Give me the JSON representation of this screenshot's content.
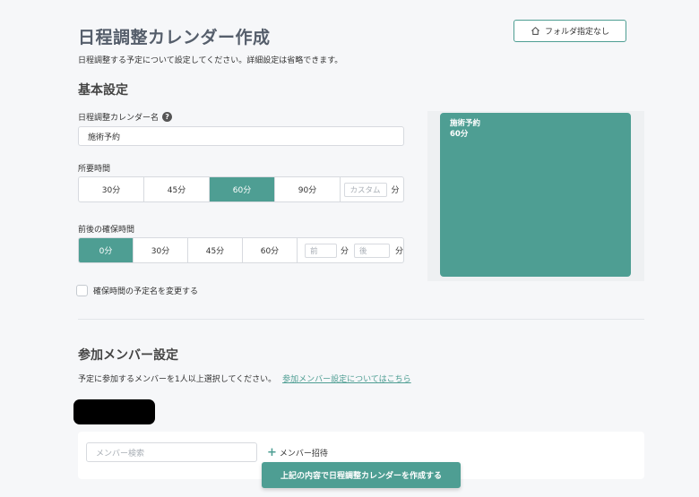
{
  "header": {
    "title": "日程調整カレンダー作成",
    "description": "日程調整する予定について設定してください。詳細設定は省略できます。",
    "folder_button": "フォルダ指定なし"
  },
  "basic": {
    "section_title": "基本設定",
    "name_label": "日程調整カレンダー名",
    "help_symbol": "?",
    "name_value": "施術予約",
    "duration_label": "所要時間",
    "duration_options": [
      "30分",
      "45分",
      "60分",
      "90分"
    ],
    "duration_selected": "60分",
    "custom_placeholder": "カスタム",
    "unit": "分",
    "buffer_label": "前後の確保時間",
    "buffer_options": [
      "0分",
      "30分",
      "45分",
      "60分"
    ],
    "buffer_selected": "0分",
    "before_placeholder": "前",
    "after_placeholder": "後",
    "rename_checkbox_label": "確保時間の予定名を変更する",
    "rename_checked": false
  },
  "preview": {
    "event_title": "施術予約",
    "event_duration": "60分",
    "event_color": "#4e9e93"
  },
  "members": {
    "section_title": "参加メンバー設定",
    "description": "予定に参加するメンバーを1人以上選択してください。",
    "link_text": "参加メンバー設定についてはこちら",
    "search_placeholder": "メンバー検索",
    "invite_label": "メンバー招待"
  },
  "footer": {
    "create_button": "上記の内容で日程調整カレンダーを作成する"
  },
  "colors": {
    "accent": "#4e9e93",
    "background": "#f6f7f9"
  },
  "icons": {
    "folder_button": "home-icon",
    "help": "help-icon",
    "invite": "plus-icon"
  }
}
